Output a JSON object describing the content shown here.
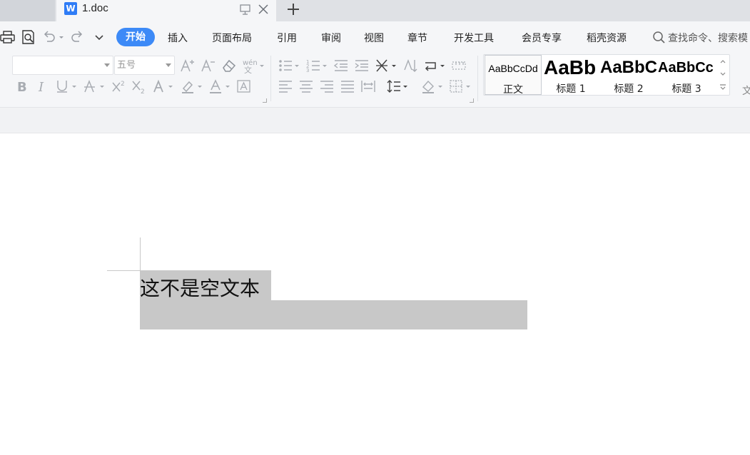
{
  "tabbar": {
    "doc_tab": {
      "icon": "word-doc-icon",
      "icon_glyph": "W",
      "name": "1.doc"
    },
    "new_tab_icon": "plus-icon"
  },
  "menubar": {
    "quick_access": [
      "print-icon",
      "print-preview-icon",
      "undo-icon",
      "redo-icon",
      "customize-dropdown-icon"
    ],
    "tabs": [
      {
        "label": "开始",
        "active": true
      },
      {
        "label": "插入"
      },
      {
        "label": "页面布局"
      },
      {
        "label": "引用"
      },
      {
        "label": "审阅"
      },
      {
        "label": "视图"
      },
      {
        "label": "章节"
      },
      {
        "label": "开发工具"
      },
      {
        "label": "会员专享"
      },
      {
        "label": "稻壳资源"
      }
    ],
    "search_text": "查找命令、搜索模"
  },
  "ribbon": {
    "font_name": "",
    "font_size": "五号",
    "styles": [
      {
        "sample": "AaBbCcDd",
        "label": "正文"
      },
      {
        "sample": "AaBb",
        "label": "标题 1"
      },
      {
        "sample": "AaBbC",
        "label": "标题 2"
      },
      {
        "sample": "AaBbCc",
        "label": "标题 3"
      }
    ],
    "overflow_label": "文"
  },
  "document": {
    "text": "这不是空文本"
  },
  "colors": {
    "accent": "#3d8af7",
    "selection": "#c8c8c8",
    "word_icon": "#2f7cf6"
  }
}
